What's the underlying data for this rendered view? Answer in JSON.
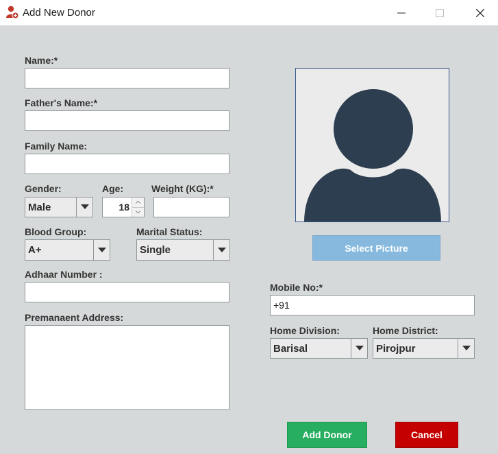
{
  "window": {
    "title": "Add New Donor"
  },
  "labels": {
    "name": "Name:*",
    "fathers_name": "Father's Name:*",
    "family_name": "Family Name:",
    "gender": "Gender:",
    "age": "Age:",
    "weight": "Weight (KG):*",
    "blood_group": "Blood Group:",
    "marital_status": "Marital Status:",
    "adhaar": "Adhaar Number :",
    "address": "Premanaent Address:",
    "mobile": "Mobile No:*",
    "home_division": "Home Division:",
    "home_district": "Home District:"
  },
  "fields": {
    "name": "",
    "fathers_name": "",
    "family_name": "",
    "gender": "Male",
    "age": "18",
    "weight": "",
    "blood_group": "A+",
    "marital_status": "Single",
    "adhaar": "",
    "address": "",
    "mobile": "+91",
    "home_division": "Barisal",
    "home_district": "Pirojpur"
  },
  "buttons": {
    "select_picture": "Select Picture",
    "add_donor": "Add Donor",
    "cancel": "Cancel"
  },
  "colors": {
    "background": "#d6d9d9",
    "select_picture": "#86b9dd",
    "add_donor": "#27ae60",
    "cancel": "#c50000",
    "avatar": "#2c3e50"
  }
}
